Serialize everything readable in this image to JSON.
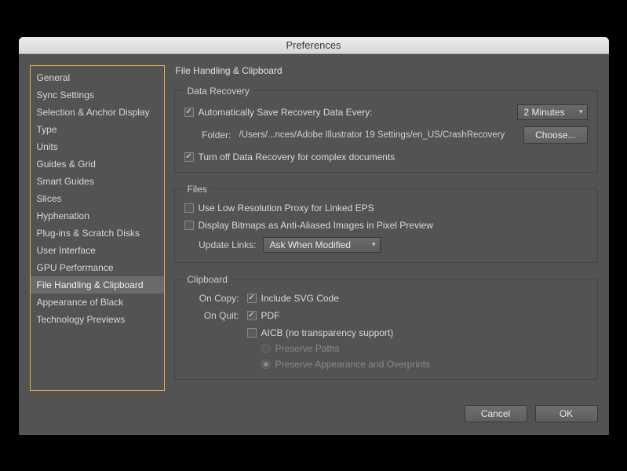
{
  "window": {
    "title": "Preferences"
  },
  "sidebar": {
    "items": [
      "General",
      "Sync Settings",
      "Selection & Anchor Display",
      "Type",
      "Units",
      "Guides & Grid",
      "Smart Guides",
      "Slices",
      "Hyphenation",
      "Plug-ins & Scratch Disks",
      "User Interface",
      "GPU Performance",
      "File Handling & Clipboard",
      "Appearance of Black",
      "Technology Previews"
    ],
    "selected_index": 12
  },
  "panel": {
    "title": "File Handling & Clipboard",
    "data_recovery": {
      "legend": "Data Recovery",
      "auto_save": {
        "label": "Automatically Save Recovery Data Every:",
        "checked": true
      },
      "interval": {
        "value": "2 Minutes"
      },
      "folder_label": "Folder:",
      "folder_path": "/Users/...nces/Adobe Illustrator 19 Settings/en_US/CrashRecovery",
      "choose_label": "Choose...",
      "turn_off": {
        "label": "Turn off Data Recovery for complex documents",
        "checked": true
      }
    },
    "files": {
      "legend": "Files",
      "low_res": {
        "label": "Use Low Resolution Proxy for Linked EPS",
        "checked": false
      },
      "bitmaps": {
        "label": "Display Bitmaps as Anti-Aliased Images in Pixel Preview",
        "checked": false
      },
      "update_links_label": "Update Links:",
      "update_links_value": "Ask When Modified"
    },
    "clipboard": {
      "legend": "Clipboard",
      "on_copy_label": "On Copy:",
      "include_svg": {
        "label": "Include SVG Code",
        "checked": true
      },
      "on_quit_label": "On Quit:",
      "pdf": {
        "label": "PDF",
        "checked": true
      },
      "aicb": {
        "label": "AICB (no transparency support)",
        "checked": false
      },
      "preserve_paths": {
        "label": "Preserve Paths"
      },
      "preserve_appearance": {
        "label": "Preserve Appearance and Overprints"
      }
    }
  },
  "footer": {
    "cancel": "Cancel",
    "ok": "OK"
  }
}
